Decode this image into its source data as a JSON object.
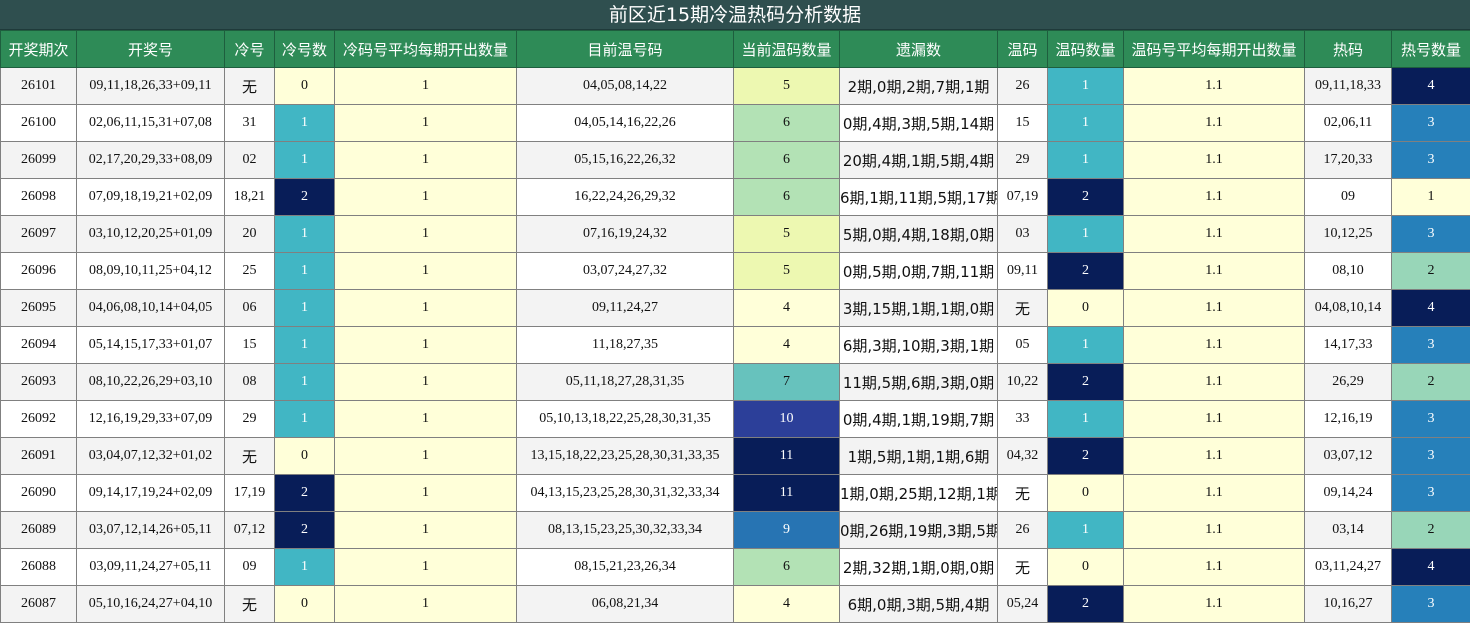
{
  "title": "前区近15期冷温热码分析数据",
  "chart_data": {
    "type": "table",
    "columns": [
      "开奖期次",
      "开奖号",
      "冷号",
      "冷号数",
      "冷码号平均每期开出数量",
      "目前温号码",
      "当前温码数量",
      "遗漏数",
      "温码",
      "温码数量",
      "温码号平均每期开出数量",
      "热码",
      "热号数量"
    ],
    "rows": [
      [
        "26101",
        "09,11,18,26,33+09,11",
        "无",
        "0",
        "1",
        "04,05,08,14,22",
        "5",
        "2期,0期,2期,7期,1期",
        "26",
        "1",
        "1.1",
        "09,11,18,33",
        "4"
      ],
      [
        "26100",
        "02,06,11,15,31+07,08",
        "31",
        "1",
        "1",
        "04,05,14,16,22,26",
        "6",
        "0期,4期,3期,5期,14期",
        "15",
        "1",
        "1.1",
        "02,06,11",
        "3"
      ],
      [
        "26099",
        "02,17,20,29,33+08,09",
        "02",
        "1",
        "1",
        "05,15,16,22,26,32",
        "6",
        "20期,4期,1期,5期,4期",
        "29",
        "1",
        "1.1",
        "17,20,33",
        "3"
      ],
      [
        "26098",
        "07,09,18,19,21+02,09",
        "18,21",
        "2",
        "1",
        "16,22,24,26,29,32",
        "6",
        "6期,1期,11期,5期,17期",
        "07,19",
        "2",
        "1.1",
        "09",
        "1"
      ],
      [
        "26097",
        "03,10,12,20,25+01,09",
        "20",
        "1",
        "1",
        "07,16,19,24,32",
        "5",
        "5期,0期,4期,18期,0期",
        "03",
        "1",
        "1.1",
        "10,12,25",
        "3"
      ],
      [
        "26096",
        "08,09,10,11,25+04,12",
        "25",
        "1",
        "1",
        "03,07,24,27,32",
        "5",
        "0期,5期,0期,7期,11期",
        "09,11",
        "2",
        "1.1",
        "08,10",
        "2"
      ],
      [
        "26095",
        "04,06,08,10,14+04,05",
        "06",
        "1",
        "1",
        "09,11,24,27",
        "4",
        "3期,15期,1期,1期,0期",
        "无",
        "0",
        "1.1",
        "04,08,10,14",
        "4"
      ],
      [
        "26094",
        "05,14,15,17,33+01,07",
        "15",
        "1",
        "1",
        "11,18,27,35",
        "4",
        "6期,3期,10期,3期,1期",
        "05",
        "1",
        "1.1",
        "14,17,33",
        "3"
      ],
      [
        "26093",
        "08,10,22,26,29+03,10",
        "08",
        "1",
        "1",
        "05,11,18,27,28,31,35",
        "7",
        "11期,5期,6期,3期,0期",
        "10,22",
        "2",
        "1.1",
        "26,29",
        "2"
      ],
      [
        "26092",
        "12,16,19,29,33+07,09",
        "29",
        "1",
        "1",
        "05,10,13,18,22,25,28,30,31,35",
        "10",
        "0期,4期,1期,19期,7期",
        "33",
        "1",
        "1.1",
        "12,16,19",
        "3"
      ],
      [
        "26091",
        "03,04,07,12,32+01,02",
        "无",
        "0",
        "1",
        "13,15,18,22,23,25,28,30,31,33,35",
        "11",
        "1期,5期,1期,1期,6期",
        "04,32",
        "2",
        "1.1",
        "03,07,12",
        "3"
      ],
      [
        "26090",
        "09,14,17,19,24+02,09",
        "17,19",
        "2",
        "1",
        "04,13,15,23,25,28,30,31,32,33,34",
        "11",
        "1期,0期,25期,12期,1期",
        "无",
        "0",
        "1.1",
        "09,14,24",
        "3"
      ],
      [
        "26089",
        "03,07,12,14,26+05,11",
        "07,12",
        "2",
        "1",
        "08,13,15,23,25,30,32,33,34",
        "9",
        "0期,26期,19期,3期,5期",
        "26",
        "1",
        "1.1",
        "03,14",
        "2"
      ],
      [
        "26088",
        "03,09,11,24,27+05,11",
        "09",
        "1",
        "1",
        "08,15,21,23,26,34",
        "6",
        "2期,32期,1期,0期,0期",
        "无",
        "0",
        "1.1",
        "03,11,24,27",
        "4"
      ],
      [
        "26087",
        "05,10,16,24,27+04,10",
        "无",
        "0",
        "1",
        "06,08,21,34",
        "4",
        "6期,0期,3期,5期,4期",
        "05,24",
        "2",
        "1.1",
        "10,16,27",
        "3"
      ]
    ],
    "heat_columns": {
      "冷号数": {
        "0": "#ffffd9",
        "1": "#41b6c4",
        "2": "#081d58"
      },
      "当前温码数量": {
        "4": "#ffffd9",
        "5": "#edf8b1",
        "6": "#b3e2b5",
        "7": "#67c2bd",
        "9": "#2774b3",
        "10": "#2c3f99",
        "11": "#081d58"
      },
      "温码数量": {
        "0": "#ffffd9",
        "1": "#41b6c4",
        "2": "#081d58"
      },
      "热号数量": {
        "1": "#ffffd9",
        "2": "#98d6b8",
        "3": "#2680ba",
        "4": "#081d58"
      }
    },
    "constant_fill": {
      "冷码号平均每期开出数量": "#ffffd9",
      "温码号平均每期开出数量": "#ffffd9"
    }
  }
}
